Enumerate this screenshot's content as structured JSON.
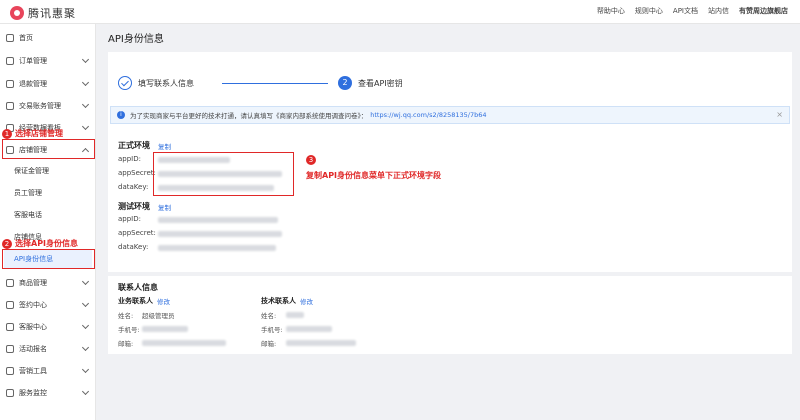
{
  "header": {
    "logo_text": "腾讯惠聚",
    "links": [
      "帮助中心",
      "规则中心",
      "API文档",
      "站内信"
    ],
    "store": "有赞周边旗舰店"
  },
  "sidebar": {
    "items": [
      {
        "label": "首页"
      },
      {
        "label": "订单管理"
      },
      {
        "label": "退款管理"
      },
      {
        "label": "交易账务管理"
      },
      {
        "label": "经营数据看板"
      },
      {
        "label": "店铺管理"
      },
      {
        "label": "保证金管理"
      },
      {
        "label": "员工管理"
      },
      {
        "label": "客服电话"
      },
      {
        "label": "店铺信息"
      },
      {
        "label": "API身份信息"
      },
      {
        "label": "商品管理"
      },
      {
        "label": "签约中心"
      },
      {
        "label": "客服中心"
      },
      {
        "label": "活动报名"
      },
      {
        "label": "营销工具"
      },
      {
        "label": "服务监控"
      }
    ]
  },
  "annotations": {
    "a1": {
      "num": "1",
      "text": "选择店铺管理"
    },
    "a2": {
      "num": "2",
      "text": "选择API身份信息"
    },
    "a3": {
      "num": "3",
      "text": "复制API身份信息菜单下正式环境字段"
    }
  },
  "page_title": "API身份信息",
  "steps": {
    "step1_label": "填写联系人信息",
    "step2_num": "2",
    "step2_label": "查看API密钥"
  },
  "notice": {
    "icon": "i",
    "text": "为了实现商家与平台更好的技术打通，请认真填写《商家内部系统使用调查问卷》：",
    "link": "https://wj.qq.com/s2/8258135/7b64",
    "close": "×"
  },
  "prod_env": {
    "title": "正式环境",
    "copy": "复制",
    "fields": [
      "appID:",
      "appSecret:",
      "dataKey:"
    ]
  },
  "test_env": {
    "title": "测试环境",
    "copy": "复制",
    "fields": [
      "appID:",
      "appSecret:",
      "dataKey:"
    ]
  },
  "contacts": {
    "title": "联系人信息",
    "biz": {
      "label": "业务联系人",
      "edit": "修改",
      "name_key": "姓名:",
      "name_val": "超级管理员",
      "phone_key": "手机号:",
      "email_key": "邮箱:"
    },
    "tech": {
      "label": "技术联系人",
      "edit": "修改",
      "name_key": "姓名:",
      "phone_key": "手机号:",
      "email_key": "邮箱:"
    }
  },
  "colors": {
    "accent": "#2f6fde",
    "annotation_red": "#e02828"
  }
}
